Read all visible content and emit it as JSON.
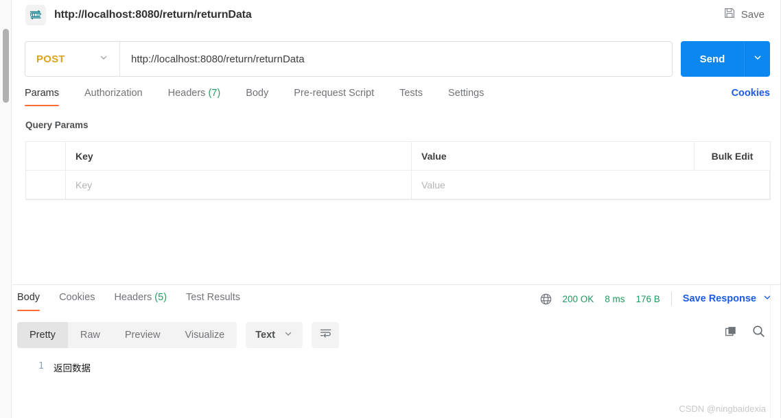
{
  "window": {
    "request_title": "http://localhost:8080/return/returnData",
    "protocol_icon_label": "HTTP",
    "save_label": "Save"
  },
  "request": {
    "method": "POST",
    "url": "http://localhost:8080/return/returnData",
    "send_label": "Send",
    "tabs": [
      {
        "label": "Params",
        "count": "",
        "active": true
      },
      {
        "label": "Authorization",
        "count": "",
        "active": false
      },
      {
        "label": "Headers",
        "count": "(7)",
        "active": false
      },
      {
        "label": "Body",
        "count": "",
        "active": false
      },
      {
        "label": "Pre-request Script",
        "count": "",
        "active": false
      },
      {
        "label": "Tests",
        "count": "",
        "active": false
      },
      {
        "label": "Settings",
        "count": "",
        "active": false
      }
    ],
    "cookies_label": "Cookies"
  },
  "query_params": {
    "section_label": "Query Params",
    "headers": {
      "key": "Key",
      "value": "Value",
      "bulk_edit": "Bulk Edit"
    },
    "rows": [
      {
        "key_placeholder": "Key",
        "value_placeholder": "Value",
        "key": "",
        "value": ""
      }
    ]
  },
  "response": {
    "tabs": [
      {
        "label": "Body",
        "count": "",
        "active": true
      },
      {
        "label": "Cookies",
        "count": "",
        "active": false
      },
      {
        "label": "Headers",
        "count": "(5)",
        "active": false
      },
      {
        "label": "Test Results",
        "count": "",
        "active": false
      }
    ],
    "status": "200 OK",
    "time": "8 ms",
    "size": "176 B",
    "save_response_label": "Save Response",
    "view_modes": [
      {
        "label": "Pretty",
        "active": true
      },
      {
        "label": "Raw",
        "active": false
      },
      {
        "label": "Preview",
        "active": false
      },
      {
        "label": "Visualize",
        "active": false
      }
    ],
    "format": "Text",
    "body_lines": [
      {
        "number": "1",
        "text": "返回数据"
      }
    ]
  },
  "watermark": "CSDN @ningbaidexia",
  "colors": {
    "accent_orange": "#ff6c37",
    "send_blue": "#0b87ef",
    "link_blue": "#1a5ce5",
    "status_green": "#1d9a5c",
    "method_post": "#d9a520",
    "http_teal": "#0d7e8c"
  }
}
